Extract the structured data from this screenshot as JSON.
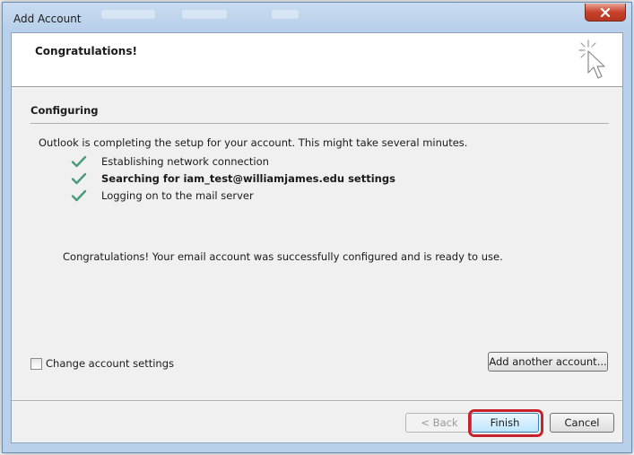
{
  "window": {
    "title": "Add Account"
  },
  "header": {
    "title": "Congratulations!",
    "icon": "cursor-sparkle-icon"
  },
  "section": {
    "label": "Configuring",
    "intro": "Outlook is completing the setup for your account. This might take several minutes."
  },
  "steps": [
    {
      "label": "Establishing network connection",
      "status": "done"
    },
    {
      "label": "Searching for iam_test@williamjames.edu settings",
      "status": "done"
    },
    {
      "label": "Logging on to the mail server",
      "status": "done"
    }
  ],
  "result": {
    "message": "Congratulations! Your email account was successfully configured and is ready to use."
  },
  "options": {
    "change_settings_label": "Change account settings",
    "change_settings_checked": false,
    "add_another_label": "Add another account..."
  },
  "footer": {
    "back_label": "< Back",
    "back_enabled": false,
    "finish_label": "Finish",
    "cancel_label": "Cancel"
  },
  "colors": {
    "check": "#4a9b7a",
    "highlight": "#c8232c",
    "close_button": "#c7412b"
  }
}
